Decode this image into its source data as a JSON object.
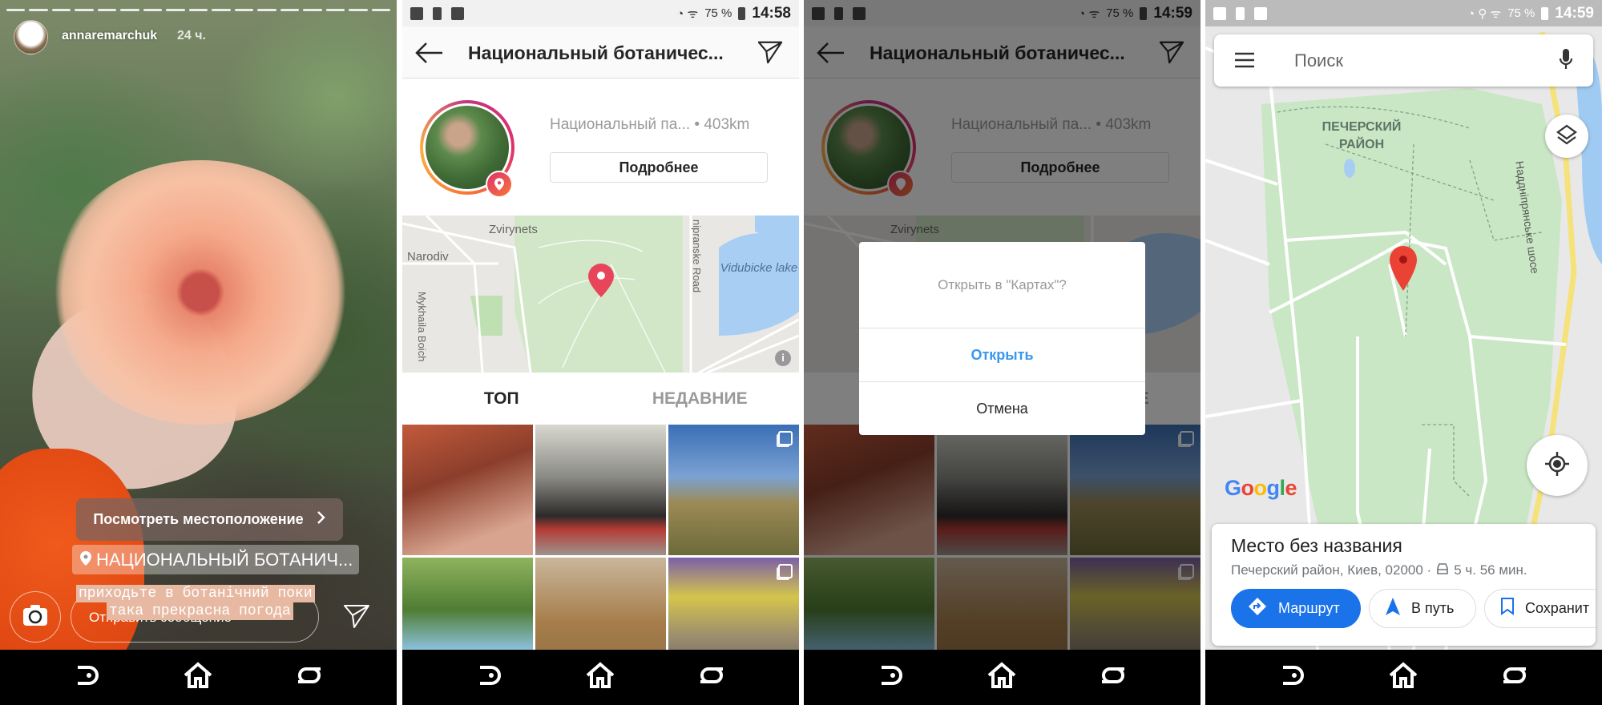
{
  "story": {
    "username": "annaremarchuk",
    "age": "24 ч.",
    "view_location": "Посмотреть местоположение",
    "location_tag": "НАЦИОНАЛЬНЫЙ БОТАНИЧ...",
    "caption_lines": [
      "приходьте в ботанічний поки",
      "така прекрасна погода"
    ],
    "message_placeholder": "Отправить сообщение"
  },
  "location_page": {
    "status": {
      "battery": "75 %",
      "time": "14:58"
    },
    "title": "Национальный ботаничес...",
    "place_name": "Национальный па...",
    "distance": "• 403km",
    "details_button": "Подробнее",
    "map_labels": {
      "zvirynets": "Zvirynets",
      "narodiv": "Narodiv",
      "street": "Mykhaila Boich",
      "road": "nipranske Road",
      "lake": "Vidubicke lake"
    },
    "tabs": {
      "top": "ТОП",
      "recent": "НЕДАВНИЕ"
    }
  },
  "dialog_screen": {
    "status": {
      "battery": "75 %",
      "time": "14:59"
    },
    "dialog": {
      "question": "Открыть в \"Картах\"?",
      "open": "Открыть",
      "cancel": "Отмена"
    }
  },
  "maps": {
    "status": {
      "battery": "75 %",
      "time": "14:59"
    },
    "search_placeholder": "Поиск",
    "district_label": "ПЕЧЕРСКИЙ РАЙОН",
    "road_label": "Наддніпрянське шосе",
    "google_logo": "Google",
    "place": {
      "name": "Место без названия",
      "address": "Печерский район, Киев, 02000 ·",
      "drive_time": "5 ч. 56 мин.",
      "route_button": "Маршрут",
      "go_button": "В путь",
      "save_button": "Сохранит"
    },
    "colors": {
      "accent": "#1a73e8",
      "pin": "#ea4335",
      "park": "#c9e7c4"
    }
  },
  "icons": [
    "camera-icon",
    "send-icon",
    "back-arrow-icon",
    "location-pin-icon",
    "info-icon",
    "menu-icon",
    "mic-icon",
    "layers-icon",
    "my-location-icon",
    "directions-icon",
    "navigation-icon",
    "bookmark-icon",
    "car-icon",
    "nav-back-icon",
    "nav-home-icon",
    "nav-recents-icon"
  ]
}
